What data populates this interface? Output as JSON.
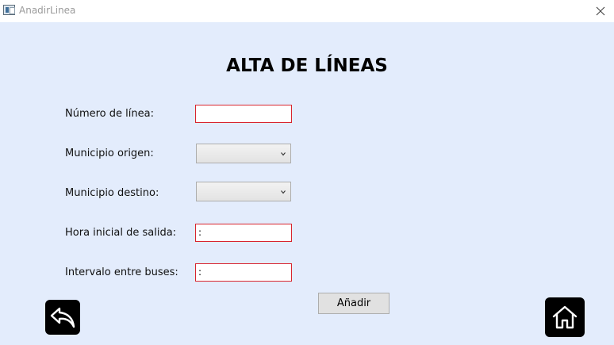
{
  "window": {
    "title": "AnadirLinea",
    "close_glyph": "✕"
  },
  "form": {
    "heading": "ALTA DE LÍNEAS",
    "fields": [
      {
        "label": "Número de línea:",
        "type": "textbox",
        "value": ""
      },
      {
        "label": "Municipio origen:",
        "type": "combobox",
        "value": ""
      },
      {
        "label": "Municipio destino:",
        "type": "combobox",
        "value": ""
      },
      {
        "label": "Hora inicial de salida:",
        "type": "textbox",
        "value": ":"
      },
      {
        "label": "Intervalo entre buses:",
        "type": "textbox",
        "value": ":"
      }
    ],
    "add_label": "Añadir"
  },
  "nav": {
    "back_icon": "back-arrow-icon",
    "home_icon": "home-icon"
  },
  "colors": {
    "background": "#e3ecfc",
    "error_border": "#d8242f",
    "nav_button": "#000000"
  }
}
